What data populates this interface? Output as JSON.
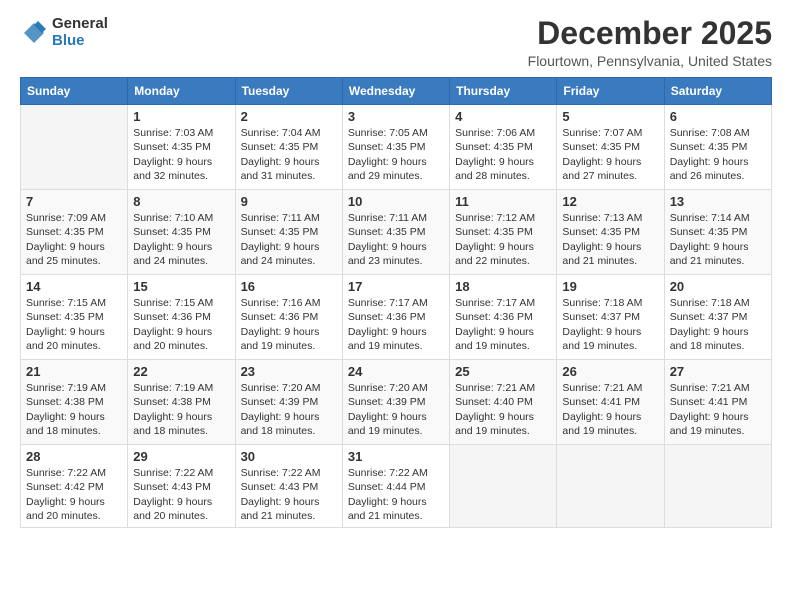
{
  "logo": {
    "general": "General",
    "blue": "Blue"
  },
  "title": "December 2025",
  "location": "Flourtown, Pennsylvania, United States",
  "weekdays": [
    "Sunday",
    "Monday",
    "Tuesday",
    "Wednesday",
    "Thursday",
    "Friday",
    "Saturday"
  ],
  "weeks": [
    [
      {
        "day": "",
        "sunrise": "",
        "sunset": "",
        "daylight": ""
      },
      {
        "day": "1",
        "sunrise": "Sunrise: 7:03 AM",
        "sunset": "Sunset: 4:35 PM",
        "daylight": "Daylight: 9 hours and 32 minutes."
      },
      {
        "day": "2",
        "sunrise": "Sunrise: 7:04 AM",
        "sunset": "Sunset: 4:35 PM",
        "daylight": "Daylight: 9 hours and 31 minutes."
      },
      {
        "day": "3",
        "sunrise": "Sunrise: 7:05 AM",
        "sunset": "Sunset: 4:35 PM",
        "daylight": "Daylight: 9 hours and 29 minutes."
      },
      {
        "day": "4",
        "sunrise": "Sunrise: 7:06 AM",
        "sunset": "Sunset: 4:35 PM",
        "daylight": "Daylight: 9 hours and 28 minutes."
      },
      {
        "day": "5",
        "sunrise": "Sunrise: 7:07 AM",
        "sunset": "Sunset: 4:35 PM",
        "daylight": "Daylight: 9 hours and 27 minutes."
      },
      {
        "day": "6",
        "sunrise": "Sunrise: 7:08 AM",
        "sunset": "Sunset: 4:35 PM",
        "daylight": "Daylight: 9 hours and 26 minutes."
      }
    ],
    [
      {
        "day": "7",
        "sunrise": "Sunrise: 7:09 AM",
        "sunset": "Sunset: 4:35 PM",
        "daylight": "Daylight: 9 hours and 25 minutes."
      },
      {
        "day": "8",
        "sunrise": "Sunrise: 7:10 AM",
        "sunset": "Sunset: 4:35 PM",
        "daylight": "Daylight: 9 hours and 24 minutes."
      },
      {
        "day": "9",
        "sunrise": "Sunrise: 7:11 AM",
        "sunset": "Sunset: 4:35 PM",
        "daylight": "Daylight: 9 hours and 24 minutes."
      },
      {
        "day": "10",
        "sunrise": "Sunrise: 7:11 AM",
        "sunset": "Sunset: 4:35 PM",
        "daylight": "Daylight: 9 hours and 23 minutes."
      },
      {
        "day": "11",
        "sunrise": "Sunrise: 7:12 AM",
        "sunset": "Sunset: 4:35 PM",
        "daylight": "Daylight: 9 hours and 22 minutes."
      },
      {
        "day": "12",
        "sunrise": "Sunrise: 7:13 AM",
        "sunset": "Sunset: 4:35 PM",
        "daylight": "Daylight: 9 hours and 21 minutes."
      },
      {
        "day": "13",
        "sunrise": "Sunrise: 7:14 AM",
        "sunset": "Sunset: 4:35 PM",
        "daylight": "Daylight: 9 hours and 21 minutes."
      }
    ],
    [
      {
        "day": "14",
        "sunrise": "Sunrise: 7:15 AM",
        "sunset": "Sunset: 4:35 PM",
        "daylight": "Daylight: 9 hours and 20 minutes."
      },
      {
        "day": "15",
        "sunrise": "Sunrise: 7:15 AM",
        "sunset": "Sunset: 4:36 PM",
        "daylight": "Daylight: 9 hours and 20 minutes."
      },
      {
        "day": "16",
        "sunrise": "Sunrise: 7:16 AM",
        "sunset": "Sunset: 4:36 PM",
        "daylight": "Daylight: 9 hours and 19 minutes."
      },
      {
        "day": "17",
        "sunrise": "Sunrise: 7:17 AM",
        "sunset": "Sunset: 4:36 PM",
        "daylight": "Daylight: 9 hours and 19 minutes."
      },
      {
        "day": "18",
        "sunrise": "Sunrise: 7:17 AM",
        "sunset": "Sunset: 4:36 PM",
        "daylight": "Daylight: 9 hours and 19 minutes."
      },
      {
        "day": "19",
        "sunrise": "Sunrise: 7:18 AM",
        "sunset": "Sunset: 4:37 PM",
        "daylight": "Daylight: 9 hours and 19 minutes."
      },
      {
        "day": "20",
        "sunrise": "Sunrise: 7:18 AM",
        "sunset": "Sunset: 4:37 PM",
        "daylight": "Daylight: 9 hours and 18 minutes."
      }
    ],
    [
      {
        "day": "21",
        "sunrise": "Sunrise: 7:19 AM",
        "sunset": "Sunset: 4:38 PM",
        "daylight": "Daylight: 9 hours and 18 minutes."
      },
      {
        "day": "22",
        "sunrise": "Sunrise: 7:19 AM",
        "sunset": "Sunset: 4:38 PM",
        "daylight": "Daylight: 9 hours and 18 minutes."
      },
      {
        "day": "23",
        "sunrise": "Sunrise: 7:20 AM",
        "sunset": "Sunset: 4:39 PM",
        "daylight": "Daylight: 9 hours and 18 minutes."
      },
      {
        "day": "24",
        "sunrise": "Sunrise: 7:20 AM",
        "sunset": "Sunset: 4:39 PM",
        "daylight": "Daylight: 9 hours and 19 minutes."
      },
      {
        "day": "25",
        "sunrise": "Sunrise: 7:21 AM",
        "sunset": "Sunset: 4:40 PM",
        "daylight": "Daylight: 9 hours and 19 minutes."
      },
      {
        "day": "26",
        "sunrise": "Sunrise: 7:21 AM",
        "sunset": "Sunset: 4:41 PM",
        "daylight": "Daylight: 9 hours and 19 minutes."
      },
      {
        "day": "27",
        "sunrise": "Sunrise: 7:21 AM",
        "sunset": "Sunset: 4:41 PM",
        "daylight": "Daylight: 9 hours and 19 minutes."
      }
    ],
    [
      {
        "day": "28",
        "sunrise": "Sunrise: 7:22 AM",
        "sunset": "Sunset: 4:42 PM",
        "daylight": "Daylight: 9 hours and 20 minutes."
      },
      {
        "day": "29",
        "sunrise": "Sunrise: 7:22 AM",
        "sunset": "Sunset: 4:43 PM",
        "daylight": "Daylight: 9 hours and 20 minutes."
      },
      {
        "day": "30",
        "sunrise": "Sunrise: 7:22 AM",
        "sunset": "Sunset: 4:43 PM",
        "daylight": "Daylight: 9 hours and 21 minutes."
      },
      {
        "day": "31",
        "sunrise": "Sunrise: 7:22 AM",
        "sunset": "Sunset: 4:44 PM",
        "daylight": "Daylight: 9 hours and 21 minutes."
      },
      {
        "day": "",
        "sunrise": "",
        "sunset": "",
        "daylight": ""
      },
      {
        "day": "",
        "sunrise": "",
        "sunset": "",
        "daylight": ""
      },
      {
        "day": "",
        "sunrise": "",
        "sunset": "",
        "daylight": ""
      }
    ]
  ]
}
